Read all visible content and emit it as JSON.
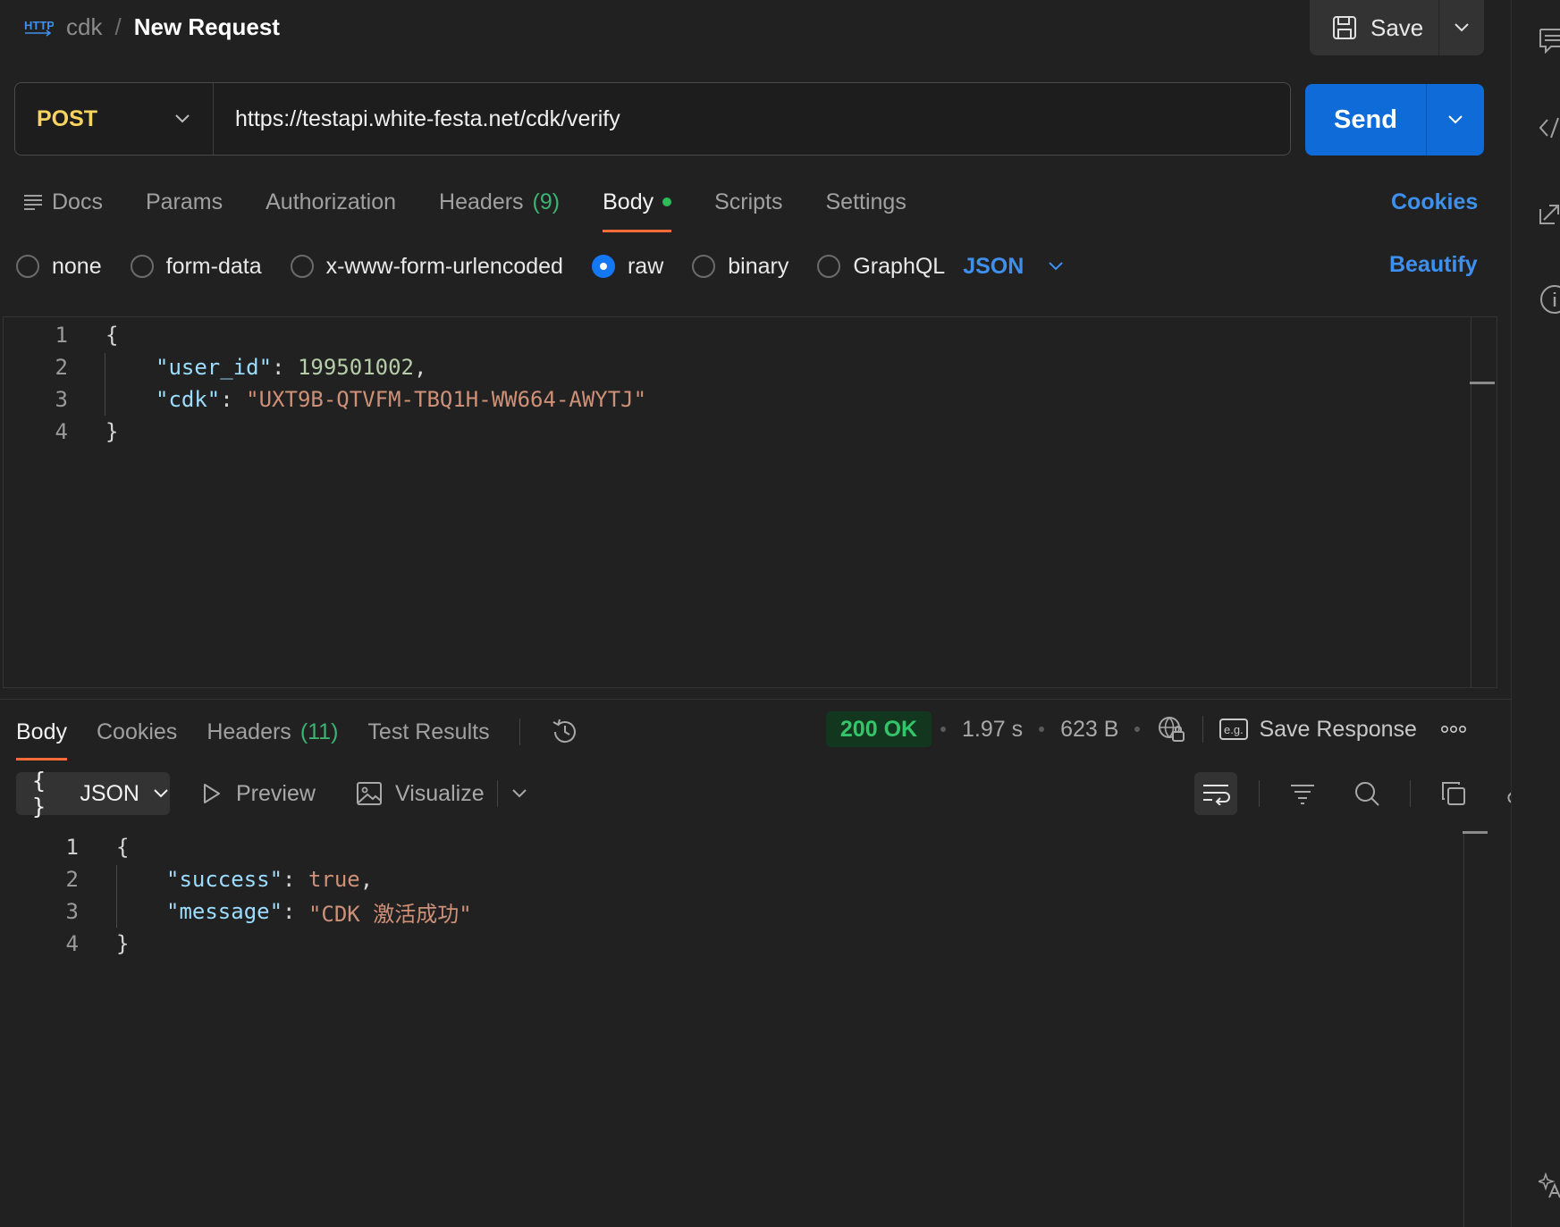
{
  "header": {
    "protocol_icon_label": "HTTP",
    "collection": "cdk",
    "separator": "/",
    "title": "New Request",
    "save_label": "Save"
  },
  "request": {
    "method": "POST",
    "url": "https://testapi.white-festa.net/cdk/verify",
    "send_label": "Send"
  },
  "request_tabs": {
    "docs": "Docs",
    "params": "Params",
    "authorization": "Authorization",
    "headers": "Headers",
    "headers_count": "(9)",
    "body": "Body",
    "scripts": "Scripts",
    "settings": "Settings",
    "cookies": "Cookies"
  },
  "body_types": {
    "none": "none",
    "form_data": "form-data",
    "urlencoded": "x-www-form-urlencoded",
    "raw": "raw",
    "binary": "binary",
    "graphql": "GraphQL",
    "selected": "raw",
    "raw_format": "JSON",
    "beautify": "Beautify"
  },
  "request_body": {
    "line_numbers": [
      "1",
      "2",
      "3",
      "4"
    ],
    "open_brace": "{",
    "close_brace": "}",
    "key1": "\"user_id\"",
    "val1": "199501002",
    "key2": "\"cdk\"",
    "val2": "\"UXT9B-QTVFM-TBQ1H-WW664-AWYTJ\"",
    "colon": ": ",
    "comma": ","
  },
  "response_tabs": {
    "body": "Body",
    "cookies": "Cookies",
    "headers": "Headers",
    "headers_count": "(11)",
    "test_results": "Test Results"
  },
  "response_meta": {
    "status": "200 OK",
    "time": "1.97 s",
    "size": "623 B",
    "save_response": "Save Response",
    "status_color": "#35c46a"
  },
  "response_toolbar": {
    "format": "JSON",
    "format_icon": "{ }",
    "preview": "Preview",
    "visualize": "Visualize"
  },
  "response_body": {
    "line_numbers": [
      "1",
      "2",
      "3",
      "4"
    ],
    "open_brace": "{",
    "close_brace": "}",
    "key1": "\"success\"",
    "val1": "true",
    "key2": "\"message\"",
    "val2": "\"CDK 激活成功\"",
    "colon": ": ",
    "comma": ","
  },
  "colors": {
    "accent": "#ff6c37",
    "send_button": "#0f6bd8",
    "link": "#3f90ee",
    "method": "#f7d35f"
  },
  "icons": {
    "protocol": "http-icon",
    "save": "floppy-disk-icon",
    "docs": "docs-lines-icon",
    "history": "history-icon",
    "network": "globe-lock-icon",
    "save_response": "example-icon",
    "more": "more-horizontal-icon",
    "wrap": "wrap-lines-icon",
    "filter": "filter-icon",
    "search": "search-icon",
    "copy": "copy-icon",
    "link": "link-icon"
  }
}
